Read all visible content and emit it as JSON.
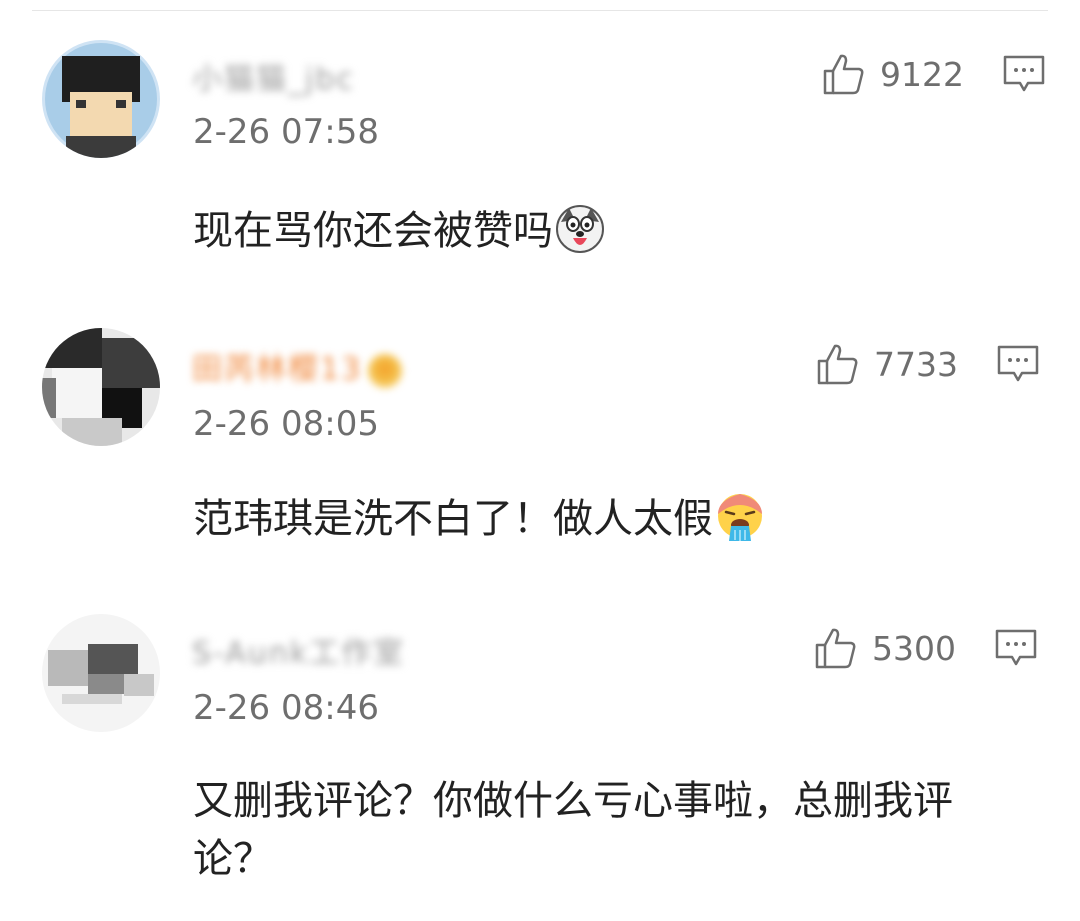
{
  "comments": [
    {
      "username": "小猫猫_jbc",
      "timestamp": "2-26 07:58",
      "text": "现在骂你还会被赞吗",
      "emoji": "husky-tongue-emoji",
      "likes": "9122",
      "username_color": "#9a9a9a"
    },
    {
      "username": "田芮林樱13",
      "timestamp": "2-26 08:05",
      "text": "范玮琪是洗不白了！做人太假",
      "emoji": "vomit-emoji",
      "likes": "7733",
      "username_color": "#f0873a"
    },
    {
      "username": "S-Aunk工作室",
      "timestamp": "2-26 08:46",
      "text": "又删我评论？你做什么亏心事啦，总删我评论？",
      "emoji": "",
      "likes": "5300",
      "username_color": "#9a9a9a"
    }
  ],
  "icons": {
    "like": "thumbs-up-outline-icon",
    "reply": "comment-bubble-icon"
  },
  "colors": {
    "meta_text": "#6e6e6e",
    "body_text": "#222222",
    "icon_stroke": "#6e6e6e"
  }
}
